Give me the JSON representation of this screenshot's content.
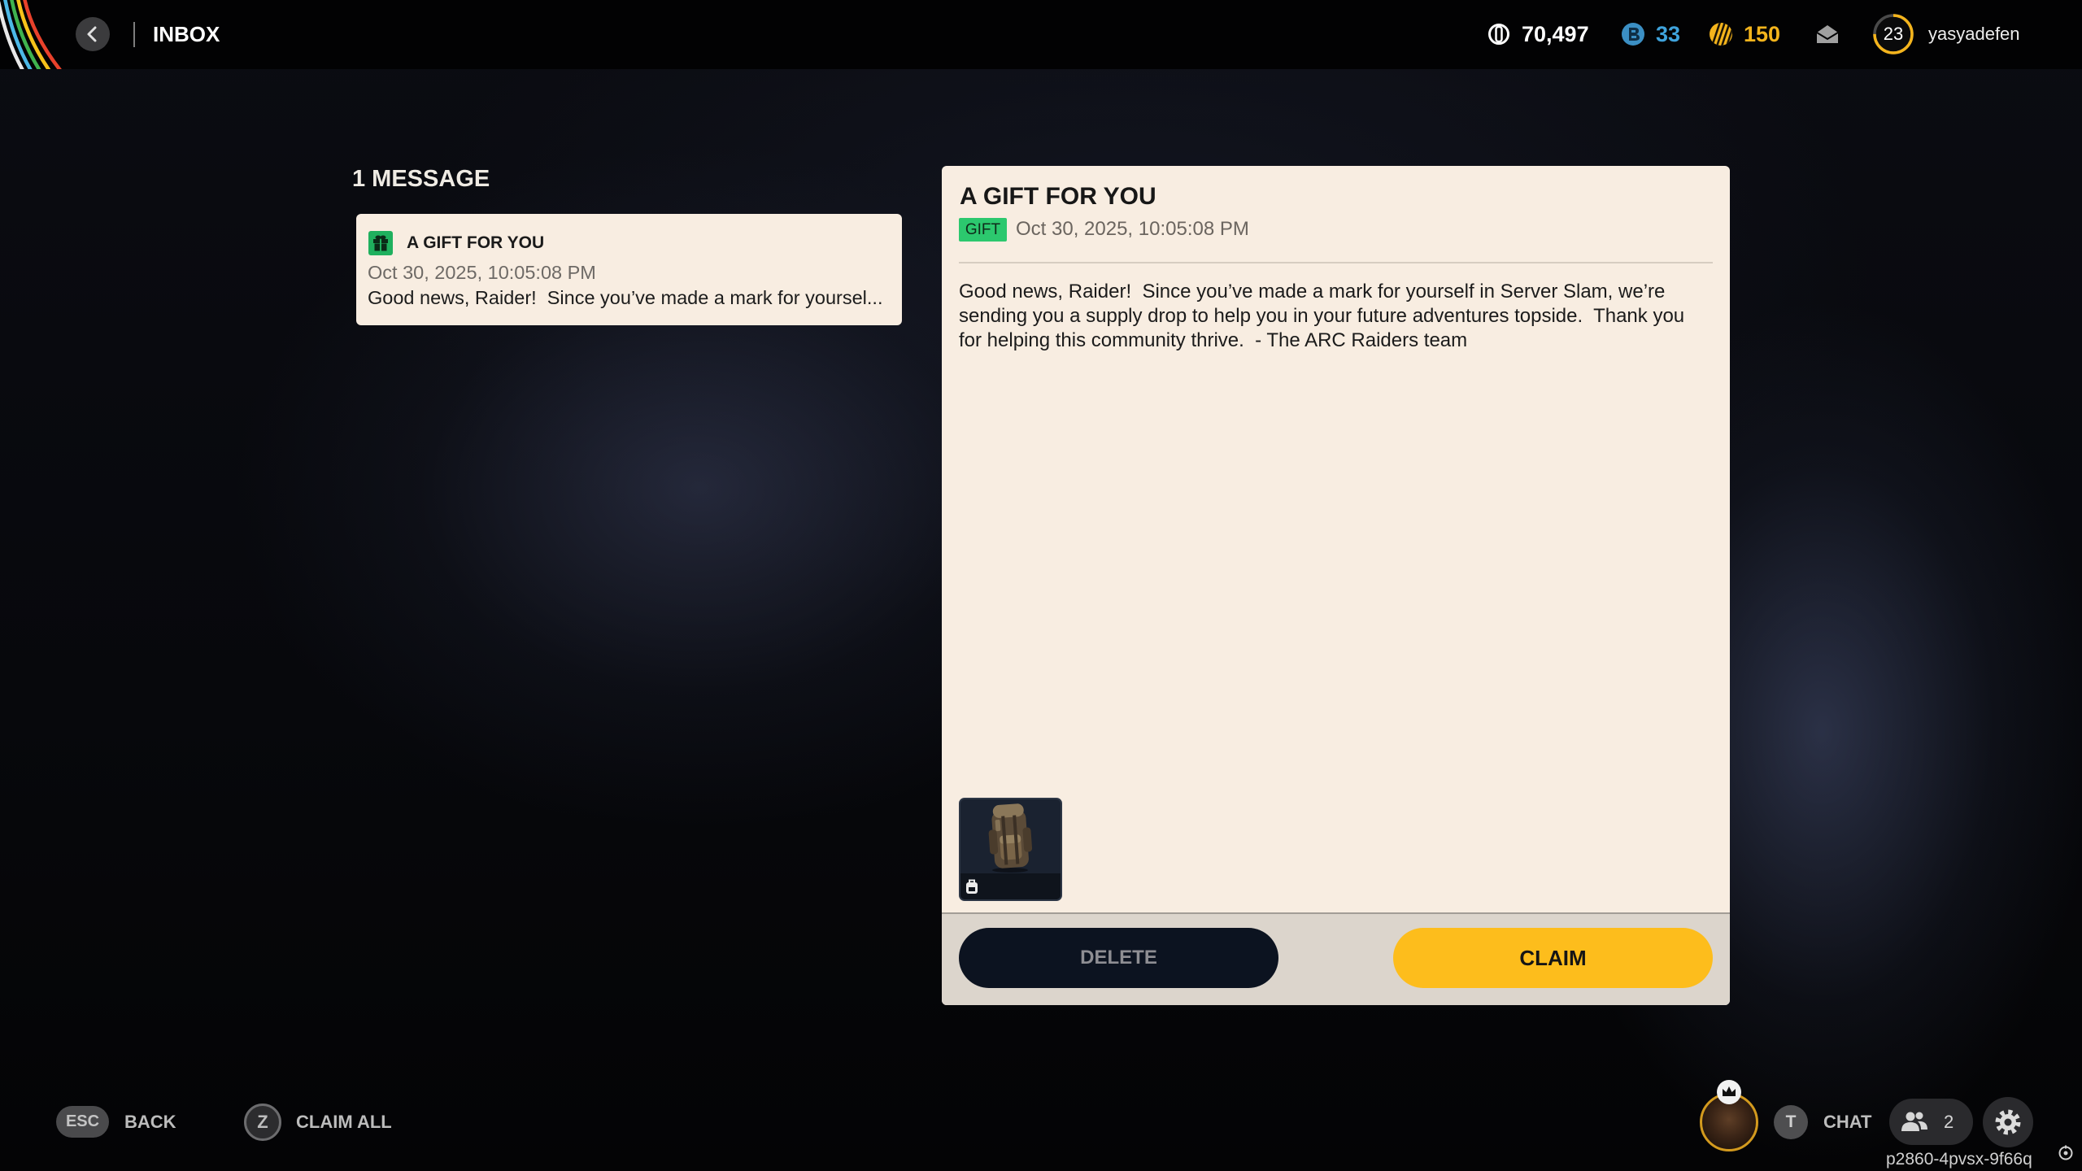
{
  "header": {
    "title": "INBOX",
    "currencies": [
      {
        "icon": "coin-icon",
        "value": "70,497",
        "color": "#ffffff"
      },
      {
        "icon": "blue-token-icon",
        "value": "33",
        "color": "#3fa3dc"
      },
      {
        "icon": "striped-token-icon",
        "value": "150",
        "color": "#f4b41c"
      }
    ],
    "mail_icon": "mail-icon",
    "profile": {
      "level": "23",
      "level_progress": 0.75,
      "username": "yasyadefen"
    }
  },
  "inbox": {
    "count_label": "1 MESSAGE",
    "messages": [
      {
        "icon": "gift-icon",
        "title": "A GIFT FOR YOU",
        "date": "Oct 30, 2025, 10:05:08 PM",
        "preview": "Good news, Raider!  Since you’ve made a mark for yoursel..."
      }
    ]
  },
  "detail": {
    "title": "A GIFT FOR YOU",
    "badge": "GIFT",
    "date": "Oct 30, 2025, 10:05:08 PM",
    "body": "Good news, Raider!  Since you’ve made a mark for yourself in Server Slam, we’re sending you a supply drop to help you in your future adventures topside.  Thank you for helping this community thrive.  - The ARC Raiders team",
    "reward": {
      "item_icon": "backpack-icon",
      "type_icon": "backpack-type-icon"
    },
    "delete_label": "DELETE",
    "claim_label": "CLAIM"
  },
  "footer": {
    "back": {
      "key": "ESC",
      "label": "BACK"
    },
    "claim_all": {
      "key": "Z",
      "label": "CLAIM ALL"
    },
    "chat": {
      "key": "T",
      "label": "CHAT"
    },
    "friends_count": "2",
    "session_id": "p2860-4pvsx-9f66q"
  },
  "colors": {
    "accent": "#fdbd1c",
    "gift_green": "#2cc86e",
    "panel": "#f8ede1",
    "panel_footer": "#dcd5cc",
    "delete_button": "#0c1320",
    "level_ring": "#f4b41c"
  }
}
